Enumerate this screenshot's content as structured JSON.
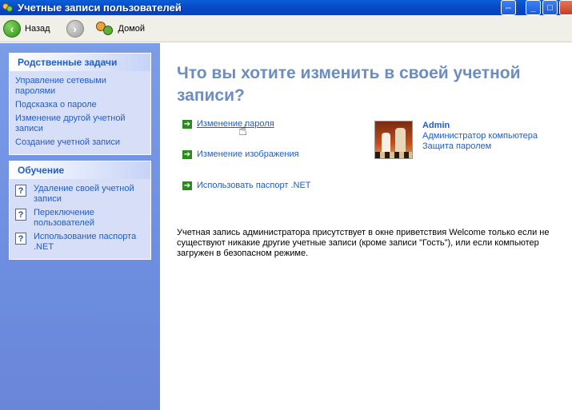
{
  "window": {
    "title": "Учетные записи пользователей",
    "buttons": {
      "restore": "⇔",
      "minimize": "_",
      "maximize": "□"
    }
  },
  "toolbar": {
    "back_label": "Назад",
    "home_label": "Домой"
  },
  "related_tasks": {
    "header": "Родственные задачи",
    "items": [
      "Управление сетевыми паролями",
      "Подсказка о пароле",
      "Изменение другой учетной записи",
      "Создание учетной записи"
    ]
  },
  "learn": {
    "header": "Обучение",
    "items": [
      "Удаление своей учетной записи",
      "Переключение пользователей",
      "Использование паспорта .NET"
    ]
  },
  "main": {
    "heading": "Что вы хотите изменить в своей учетной записи?",
    "actions": [
      "Изменение пароля",
      "Изменение изображения",
      "Использовать паспорт .NET"
    ],
    "user": {
      "name": "Admin",
      "role": "Администратор компьютера",
      "status": "Защита паролем"
    },
    "note": "Учетная запись администратора присутствует в окне приветствия Welcome только если не существуют никакие другие учетные записи (кроме записи \"Гость\"), или если компьютер загружен в безопасном режиме."
  },
  "colors": {
    "titlebar": "#0848c8",
    "sidebar": "#7b9ce7",
    "link": "#215dc6",
    "heading": "#6b8dc1",
    "arrow": "#2b8a1e"
  }
}
